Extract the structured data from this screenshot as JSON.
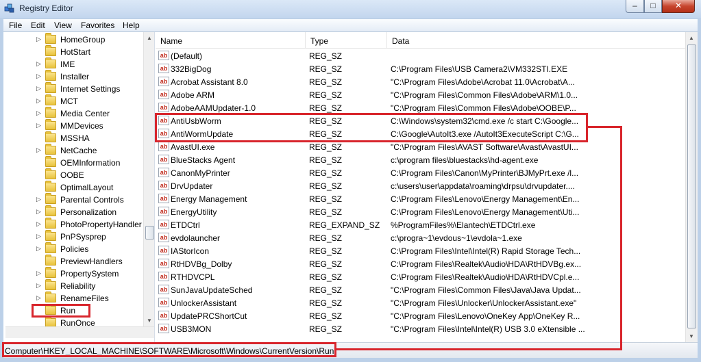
{
  "window": {
    "title": "Registry Editor",
    "minimize": "–",
    "maximize": "□",
    "close": "✕"
  },
  "menu": [
    "File",
    "Edit",
    "View",
    "Favorites",
    "Help"
  ],
  "tree": {
    "items": [
      "HomeGroup",
      "HotStart",
      "IME",
      "Installer",
      "Internet Settings",
      "MCT",
      "Media Center",
      "MMDevices",
      "MSSHA",
      "NetCache",
      "OEMInformation",
      "OOBE",
      "OptimalLayout",
      "Parental Controls",
      "Personalization",
      "PhotoPropertyHandler",
      "PnPSysprep",
      "Policies",
      "PreviewHandlers",
      "PropertySystem",
      "Reliability",
      "RenameFiles",
      "Run",
      "RunOnce"
    ],
    "expandable": [
      true,
      false,
      true,
      true,
      true,
      true,
      true,
      true,
      false,
      true,
      false,
      false,
      false,
      true,
      true,
      true,
      true,
      true,
      false,
      true,
      true,
      true,
      false,
      false
    ],
    "selected": "Run"
  },
  "list": {
    "columns": [
      "Name",
      "Type",
      "Data"
    ],
    "rows": [
      [
        "(Default)",
        "REG_SZ",
        ""
      ],
      [
        "332BigDog",
        "REG_SZ",
        "C:\\Program Files\\USB Camera2\\VM332STI.EXE"
      ],
      [
        "Acrobat Assistant 8.0",
        "REG_SZ",
        "\"C:\\Program Files\\Adobe\\Acrobat 11.0\\Acrobat\\A..."
      ],
      [
        "Adobe ARM",
        "REG_SZ",
        "\"C:\\Program Files\\Common Files\\Adobe\\ARM\\1.0..."
      ],
      [
        "AdobeAAMUpdater-1.0",
        "REG_SZ",
        "\"C:\\Program Files\\Common Files\\Adobe\\OOBE\\P..."
      ],
      [
        "AntiUsbWorm",
        "REG_SZ",
        "C:\\Windows\\system32\\cmd.exe /c start C:\\Google..."
      ],
      [
        "AntiWormUpdate",
        "REG_SZ",
        "C:\\Google\\AutoIt3.exe /AutoIt3ExecuteScript C:\\G..."
      ],
      [
        "AvastUI.exe",
        "REG_SZ",
        "\"C:\\Program Files\\AVAST Software\\Avast\\AvastUI..."
      ],
      [
        "BlueStacks Agent",
        "REG_SZ",
        "c:\\program files\\bluestacks\\hd-agent.exe"
      ],
      [
        "CanonMyPrinter",
        "REG_SZ",
        "C:\\Program Files\\Canon\\MyPrinter\\BJMyPrt.exe /l..."
      ],
      [
        "DrvUpdater",
        "REG_SZ",
        "c:\\users\\user\\appdata\\roaming\\drpsu\\drvupdater...."
      ],
      [
        "Energy Management",
        "REG_SZ",
        "C:\\Program Files\\Lenovo\\Energy Management\\En..."
      ],
      [
        "EnergyUtility",
        "REG_SZ",
        "C:\\Program Files\\Lenovo\\Energy Management\\Uti..."
      ],
      [
        "ETDCtrl",
        "REG_EXPAND_SZ",
        "%ProgramFiles%\\Elantech\\ETDCtrl.exe"
      ],
      [
        "evdolauncher",
        "REG_SZ",
        "c:\\progra~1\\evdous~1\\evdola~1.exe"
      ],
      [
        "IAStorIcon",
        "REG_SZ",
        "C:\\Program Files\\Intel\\Intel(R) Rapid Storage Tech..."
      ],
      [
        "RtHDVBg_Dolby",
        "REG_SZ",
        "C:\\Program Files\\Realtek\\Audio\\HDA\\RtHDVBg.ex..."
      ],
      [
        "RTHDVCPL",
        "REG_SZ",
        "C:\\Program Files\\Realtek\\Audio\\HDA\\RtHDVCpl.e..."
      ],
      [
        "SunJavaUpdateSched",
        "REG_SZ",
        "\"C:\\Program Files\\Common Files\\Java\\Java Updat..."
      ],
      [
        "UnlockerAssistant",
        "REG_SZ",
        "\"C:\\Program Files\\Unlocker\\UnlockerAssistant.exe\""
      ],
      [
        "UpdatePRCShortCut",
        "REG_SZ",
        "\"C:\\Program Files\\Lenovo\\OneKey App\\OneKey R..."
      ],
      [
        "USB3MON",
        "REG_SZ",
        "\"C:\\Program Files\\Intel\\Intel(R) USB 3.0 eXtensible ..."
      ]
    ],
    "highlighted": [
      "AntiUsbWorm",
      "AntiWormUpdate"
    ]
  },
  "status": {
    "path": "Computer\\HKEY_LOCAL_MACHINE\\SOFTWARE\\Microsoft\\Windows\\CurrentVersion\\Run"
  },
  "colors": {
    "annotation_red": "#d8252c",
    "window_frame": "#bcd0e8"
  },
  "icons": {
    "value_icon": "ab",
    "folder": "folder-icon",
    "app": "registry-icon"
  }
}
